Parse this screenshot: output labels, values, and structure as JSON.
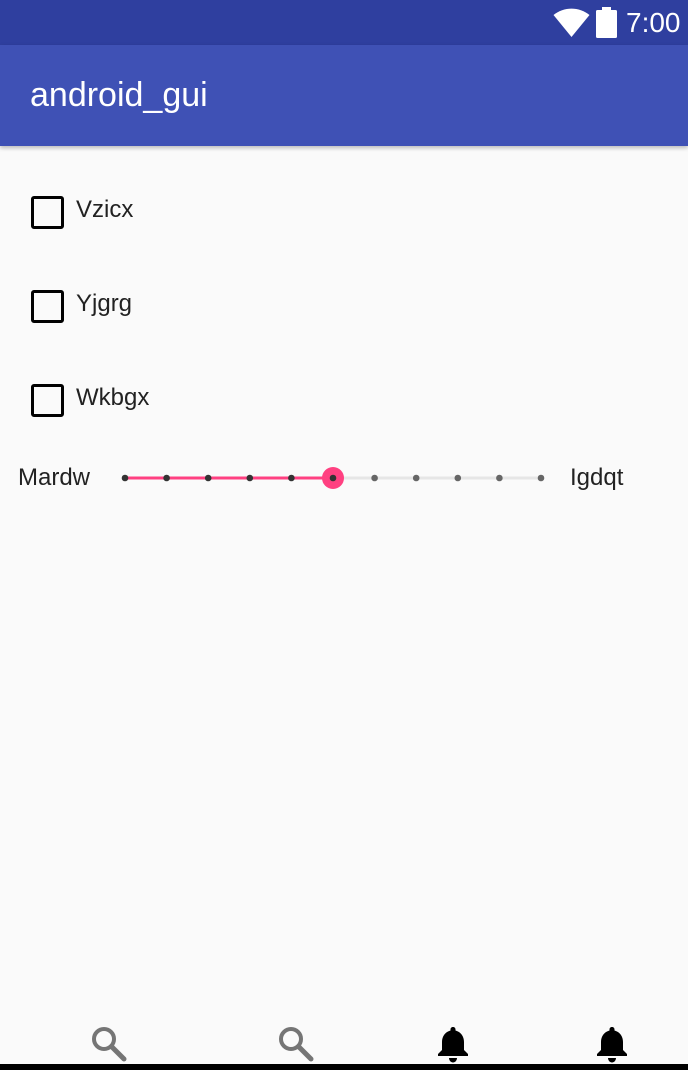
{
  "status_bar": {
    "time": "7:00",
    "icons": [
      "wifi-icon",
      "battery-icon"
    ]
  },
  "app_bar": {
    "title": "android_gui"
  },
  "checkboxes": [
    {
      "label": "Vzicx",
      "checked": false
    },
    {
      "label": "Yjgrg",
      "checked": false
    },
    {
      "label": "Wkbgx",
      "checked": false
    }
  ],
  "slider": {
    "left_label": "Mardw",
    "right_label": "Igdqt",
    "steps": 10,
    "value_step": 5,
    "active_color": "#ff4081",
    "inactive_color": "#e6e6e6",
    "tick_color": "#666666"
  },
  "bottom_nav": {
    "items": [
      {
        "icon": "search-icon"
      },
      {
        "icon": "search-icon"
      },
      {
        "icon": "bell-icon"
      },
      {
        "icon": "bell-icon"
      }
    ]
  },
  "colors": {
    "status_bar": "#2f3f9f",
    "app_bar": "#3f51b5",
    "background": "#fafafa"
  }
}
